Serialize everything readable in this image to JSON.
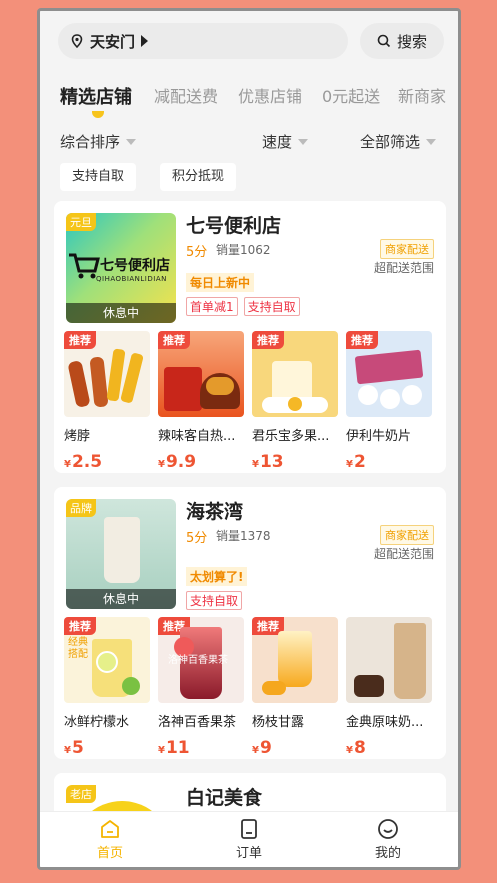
{
  "header": {
    "location": "天安门",
    "search_label": "搜索"
  },
  "tabs": [
    "精选店铺",
    "减配送费",
    "优惠店铺",
    "0元起送",
    "新商家"
  ],
  "sort": {
    "comprehensive": "综合排序",
    "speed": "速度",
    "filter": "全部筛选"
  },
  "chips": [
    "支持自取",
    "积分抵现"
  ],
  "stores": [
    {
      "name": "七号便利店",
      "corner_tag": "元旦",
      "logo_title": "七号便利店",
      "logo_sub": "QIHAOBIANLIDIAN",
      "status": "休息中",
      "score": "5分",
      "sales": "销量1062",
      "delivery_badge": "商家配送",
      "range": "超配送范围",
      "promo": "每日上新中",
      "tags": [
        "首单减1",
        "支持自取"
      ],
      "products": [
        {
          "badge": "推荐",
          "name": "烤脖",
          "price": "2.5"
        },
        {
          "badge": "推荐",
          "name": "辣味客自热...",
          "price": "9.9"
        },
        {
          "badge": "推荐",
          "name": "君乐宝多果...",
          "price": "13"
        },
        {
          "badge": "推荐",
          "name": "伊利牛奶片",
          "price": "2"
        }
      ]
    },
    {
      "name": "海茶湾",
      "corner_tag": "品牌",
      "status": "休息中",
      "score": "5分",
      "sales": "销量1378",
      "delivery_badge": "商家配送",
      "range": "超配送范围",
      "promo": "太划算了!",
      "tags": [
        "支持自取"
      ],
      "products": [
        {
          "badge": "推荐",
          "name": "冰鲜柠檬水",
          "price": "5",
          "img_text": "经典搭配"
        },
        {
          "badge": "推荐",
          "name": "洛神百香果茶",
          "price": "11",
          "img_text": "洛神百香果茶"
        },
        {
          "badge": "推荐",
          "name": "杨枝甘露",
          "price": "9"
        },
        {
          "badge": "",
          "name": "金典原味奶...",
          "price": "8"
        }
      ]
    },
    {
      "name": "白记美食",
      "corner_tag": "老店"
    }
  ],
  "currency": "¥",
  "nav": [
    "首页",
    "订单",
    "我的"
  ],
  "colors": {
    "accent": "#f5b400",
    "price": "#e53",
    "badge": "#ee4b3c",
    "background": "#f3907a"
  }
}
